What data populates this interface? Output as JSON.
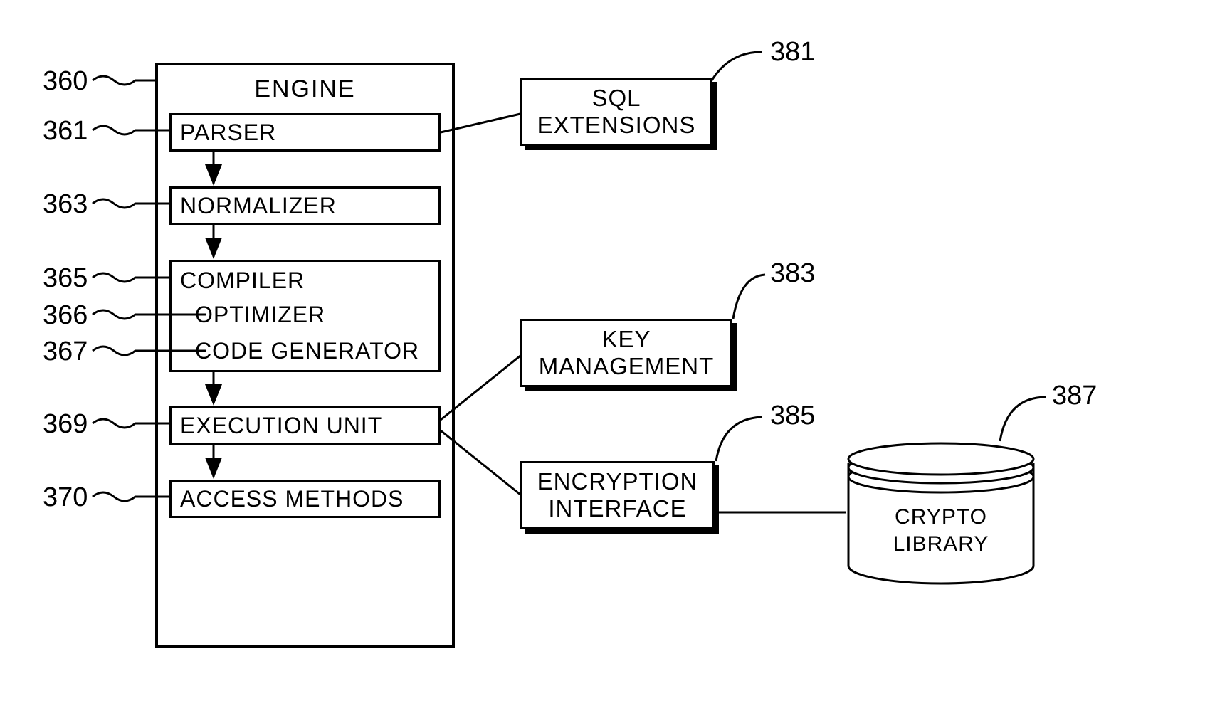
{
  "engine": {
    "title": "ENGINE",
    "parser": "PARSER",
    "normalizer": "NORMALIZER",
    "compiler": "COMPILER",
    "optimizer": "OPTIMIZER",
    "codegen": "CODE GENERATOR",
    "execunit": "EXECUTION UNIT",
    "access": "ACCESS METHODS"
  },
  "ext": {
    "sql1": "SQL",
    "sql2": "EXTENSIONS",
    "key1": "KEY",
    "key2": "MANAGEMENT",
    "enc1": "ENCRYPTION",
    "enc2": "INTERFACE",
    "crypto1": "CRYPTO",
    "crypto2": "LIBRARY"
  },
  "nums": {
    "n360": "360",
    "n361": "361",
    "n363": "363",
    "n365": "365",
    "n366": "366",
    "n367": "367",
    "n369": "369",
    "n370": "370",
    "n381": "381",
    "n383": "383",
    "n385": "385",
    "n387": "387"
  }
}
